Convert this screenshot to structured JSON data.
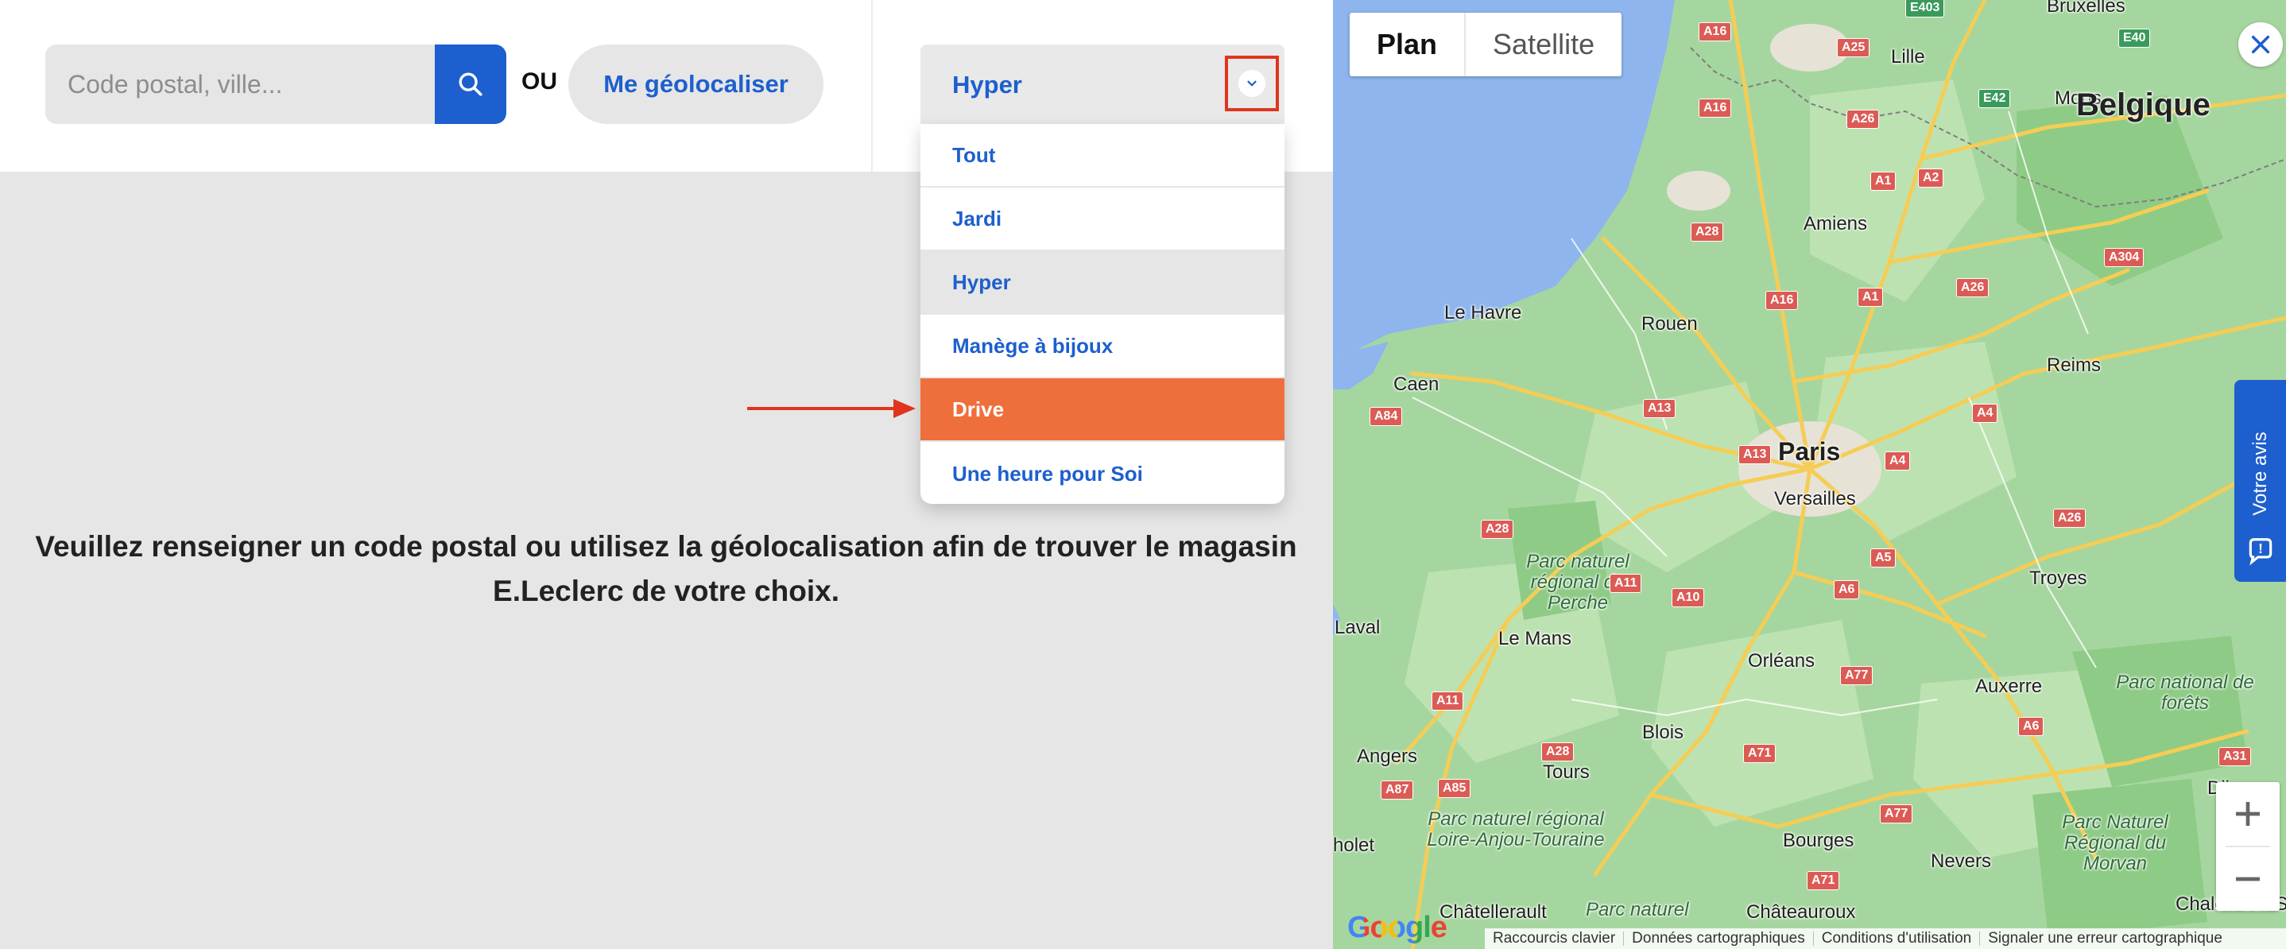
{
  "search": {
    "placeholder": "Code postal, ville...",
    "or_label": "OU",
    "geolocate_label": "Me géolocaliser"
  },
  "store_type": {
    "selected": "Hyper",
    "options": [
      {
        "label": "Tout"
      },
      {
        "label": "Jardi"
      },
      {
        "label": "Hyper"
      },
      {
        "label": "Manège à bijoux"
      },
      {
        "label": "Drive"
      },
      {
        "label": "Une heure pour Soi"
      }
    ]
  },
  "message": {
    "line1": "Veuillez renseigner un code postal ou utilisez la géolocalisation afin de trouver le magasin",
    "line2": "E.Leclerc de votre choix."
  },
  "map": {
    "type_plan": "Plan",
    "type_satellite": "Satellite",
    "feedback_label": "Votre avis",
    "logo": "Google",
    "places": {
      "bruxelles": "Bruxelles",
      "lille": "Lille",
      "mons": "Mons",
      "belgique": "Belgique",
      "amiens": "Amiens",
      "le_havre": "Le Havre",
      "rouen": "Rouen",
      "caen": "Caen",
      "reims": "Reims",
      "paris": "Paris",
      "versailles": "Versailles",
      "parc_perche": "Parc naturel régional du Perche",
      "troyes": "Troyes",
      "laval": "Laval",
      "le_mans": "Le Mans",
      "orleans": "Orléans",
      "auxerre": "Auxerre",
      "parc_forets": "Parc national de forêts",
      "angers": "Angers",
      "blois": "Blois",
      "tours": "Tours",
      "parc_loire": "Parc naturel régional Loire-Anjou-Touraine",
      "cholet": "holet",
      "bourges": "Bourges",
      "nevers": "Nevers",
      "parc_morvan": "Parc Naturel Régional du Morvan",
      "dijon": "Dijo",
      "chatellerault": "Châtellerault",
      "chateauroux": "Châteauroux",
      "chalon": "Chalon-sur-S",
      "parc_bottom": "Parc naturel"
    },
    "roads": {
      "a16a": "A16",
      "e403": "E403",
      "a25": "A25",
      "e40": "E40",
      "e42": "E42",
      "a16b": "A16",
      "a26a": "A26",
      "a1a": "A1",
      "a2": "A2",
      "a28a": "A28",
      "a16c": "A16",
      "a1b": "A1",
      "a26b": "A26",
      "a304": "A304",
      "a84": "A84",
      "a13a": "A13",
      "a4a": "A4",
      "a13b": "A13",
      "a4b": "A4",
      "a28b": "A28",
      "a26c": "A26",
      "a5": "A5",
      "a11a": "A11",
      "a10": "A10",
      "a6a": "A6",
      "a77a": "A77",
      "a11b": "A11",
      "a6b": "A6",
      "a28c": "A28",
      "a71a": "A71",
      "a31": "A31",
      "a87": "A87",
      "a85": "A85",
      "a77b": "A77",
      "a71b": "A71"
    },
    "attribution": {
      "shortcuts": "Raccourcis clavier",
      "data": "Données cartographiques",
      "terms": "Conditions d'utilisation",
      "report": "Signaler une erreur cartographique"
    }
  }
}
